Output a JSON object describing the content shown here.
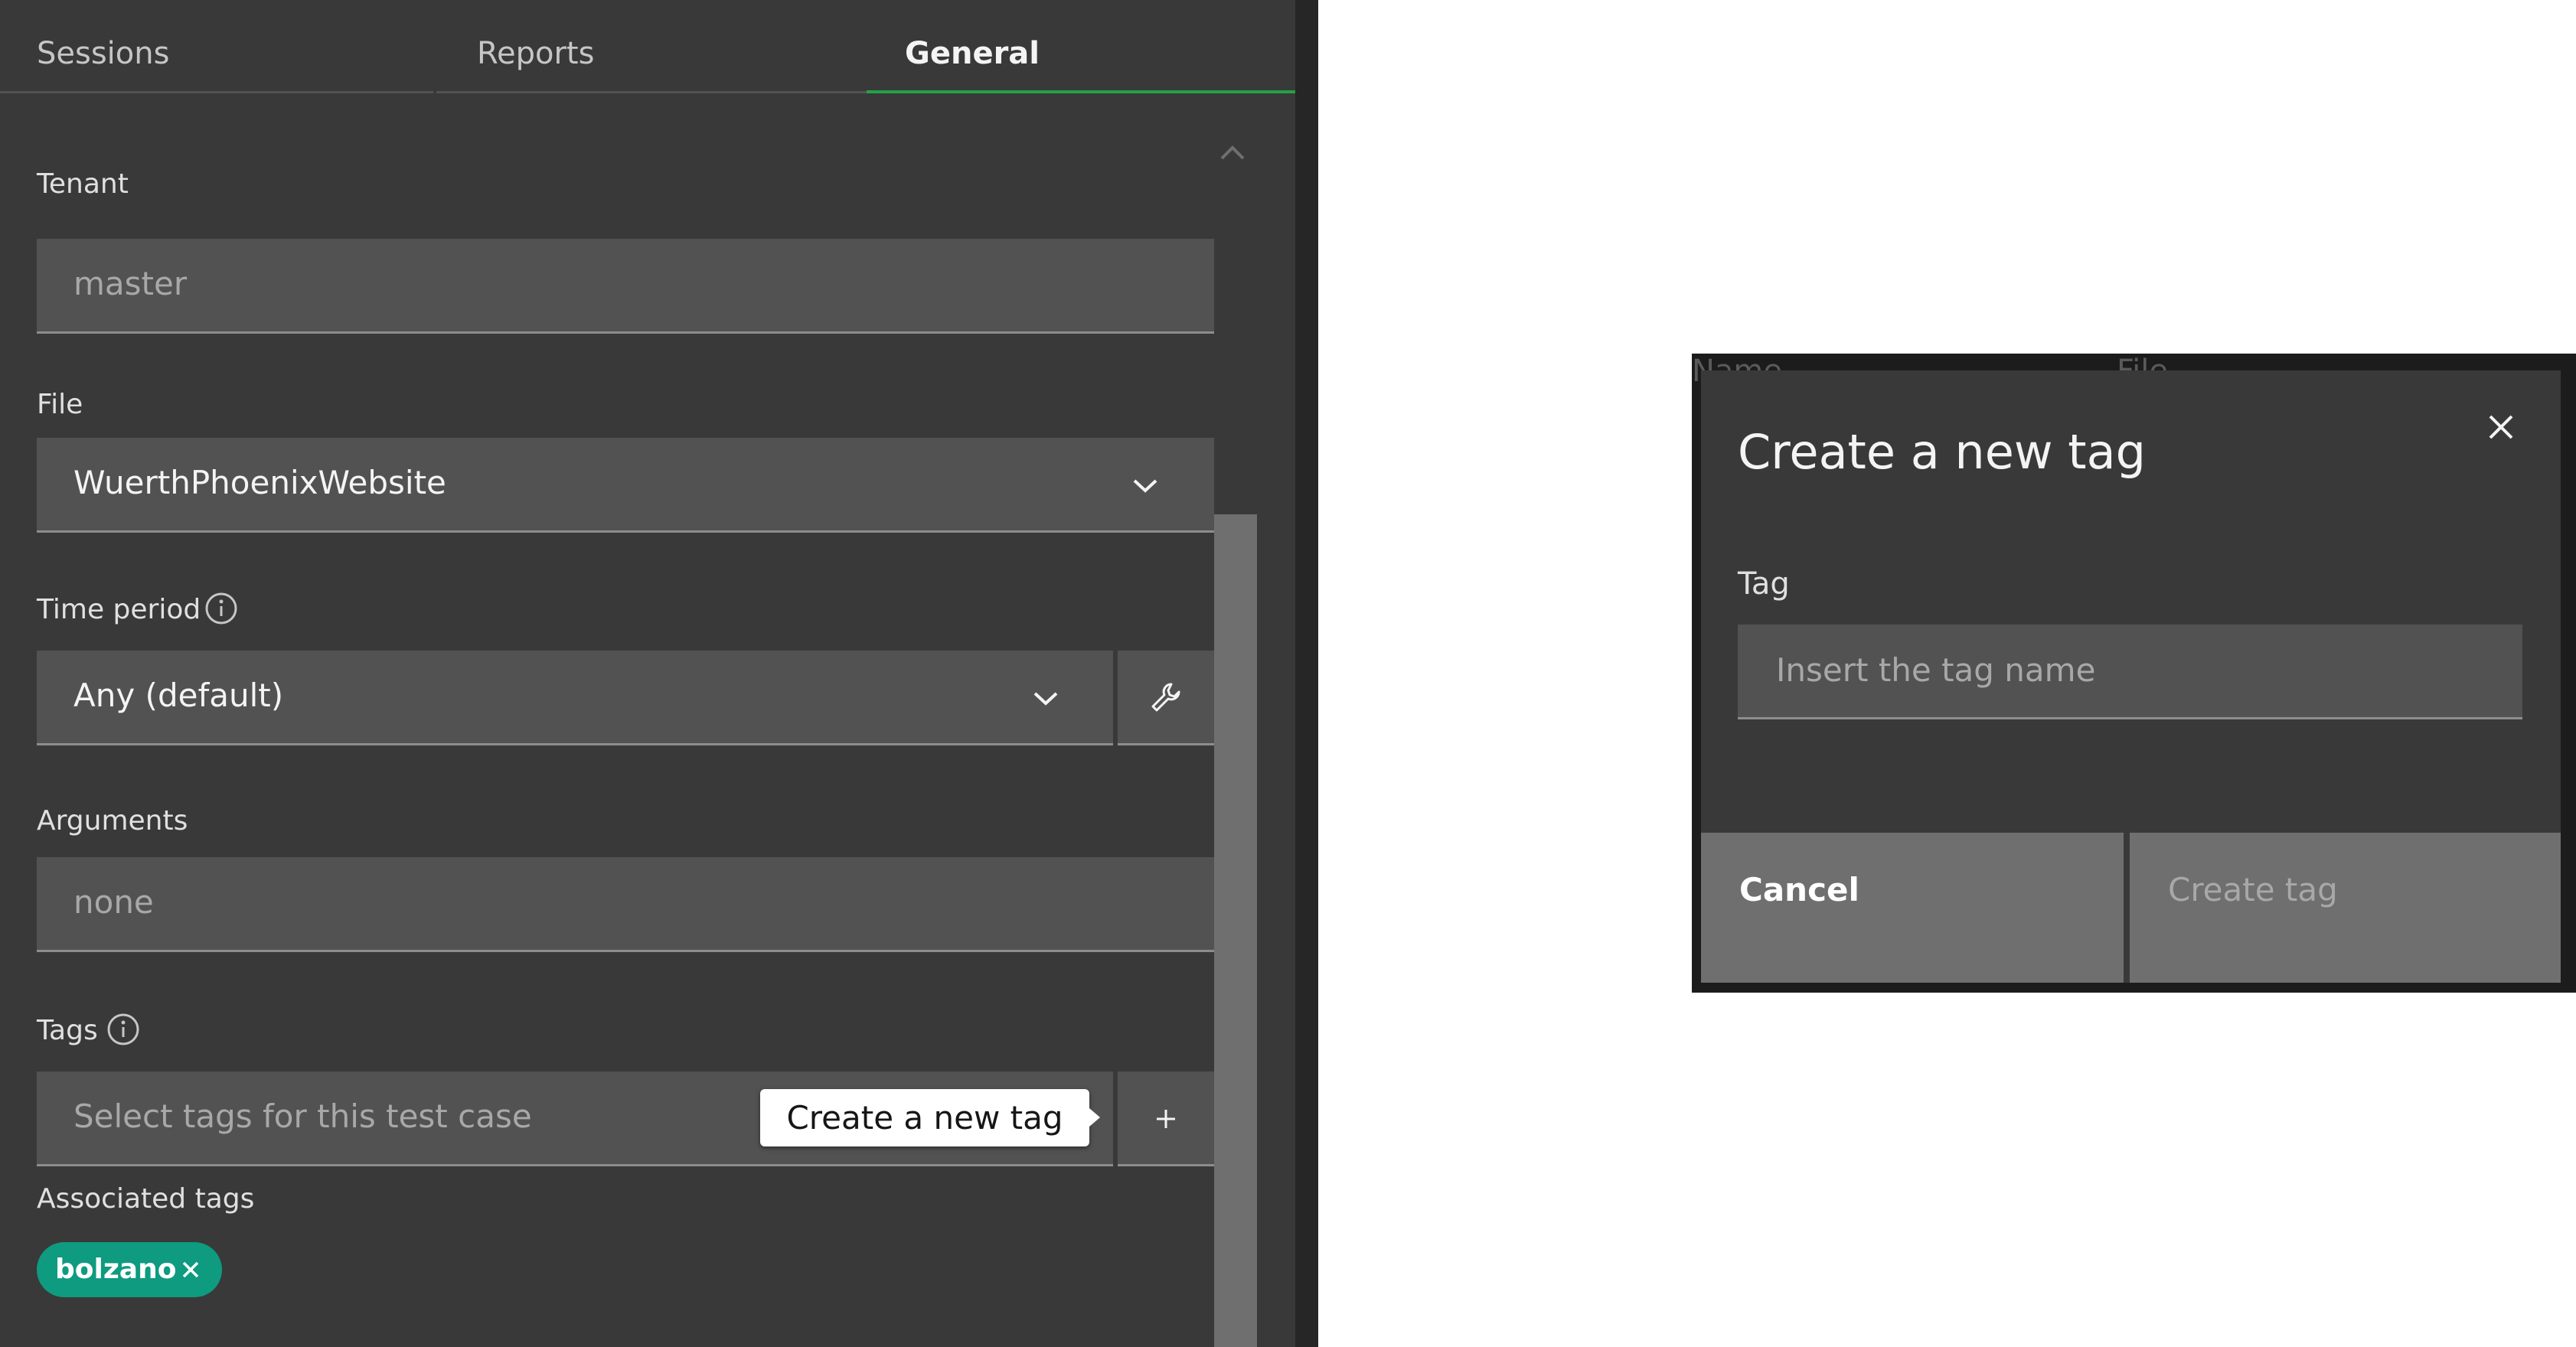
{
  "tabs": [
    {
      "label": "Sessions"
    },
    {
      "label": "Reports"
    },
    {
      "label": "General",
      "active": true
    }
  ],
  "form": {
    "tenant": {
      "label": "Tenant",
      "value": "master"
    },
    "file": {
      "label": "File",
      "value": "WuerthPhoenixWebsite"
    },
    "time_period": {
      "label": "Time period",
      "value": "Any (default)"
    },
    "arguments": {
      "label": "Arguments",
      "value": "none"
    },
    "tags": {
      "label": "Tags",
      "placeholder": "Select tags for this test case"
    },
    "associated_tags": {
      "label": "Associated tags",
      "items": [
        {
          "name": "bolzano"
        }
      ]
    }
  },
  "tooltip": {
    "text": "Create a new tag"
  },
  "modal": {
    "title": "Create a new tag",
    "tag_label": "Tag",
    "tag_placeholder": "Insert the tag name",
    "cancel_label": "Cancel",
    "create_label": "Create tag",
    "background_fragments": [
      "Name",
      "File"
    ]
  },
  "colors": {
    "panel_bg": "#393939",
    "field_bg": "#525252",
    "active_tab_underline": "#24a148",
    "tag_chip": "#0e9b80",
    "modal_button": "#6f6f6f"
  },
  "icons": [
    "chevron-up-icon",
    "chevron-down-icon",
    "info-icon",
    "wrench-icon",
    "plus-icon",
    "close-icon"
  ]
}
